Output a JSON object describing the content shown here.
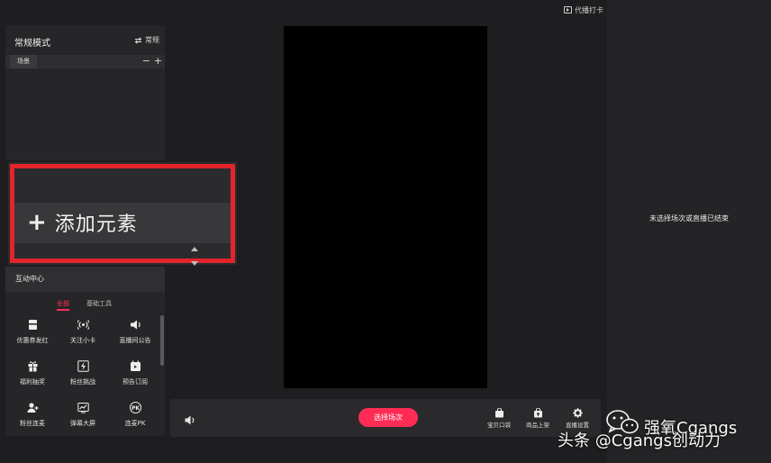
{
  "top_bar": {
    "assist_label": "代播打卡"
  },
  "scene_panel": {
    "title": "常规模式",
    "switch_label": "常规",
    "switch_icon": "swap-icon",
    "scene_tab": "场景",
    "minus": "−",
    "plus": "+"
  },
  "add_element": {
    "plus": "+",
    "label": "添加元素"
  },
  "interaction": {
    "title": "互动中心",
    "tabs": [
      {
        "label": "全部",
        "active": true
      },
      {
        "label": "基础工具",
        "active": false
      }
    ],
    "tools": [
      {
        "label": "优惠券发红",
        "icon": "coupon-icon",
        "glyph": "▣"
      },
      {
        "label": "关注小卡",
        "icon": "signal-icon",
        "glyph": "((•))"
      },
      {
        "label": "直播间公告",
        "icon": "speaker-icon",
        "glyph": "◀)"
      },
      {
        "label": "福利抽奖",
        "icon": "gift-icon",
        "glyph": "▦"
      },
      {
        "label": "粉丝挑战",
        "icon": "flash-icon",
        "glyph": "⚡"
      },
      {
        "label": "预告订阅",
        "icon": "calendar-icon",
        "glyph": "▤"
      },
      {
        "label": "粉丝连麦",
        "icon": "user-add-icon",
        "glyph": "☻"
      },
      {
        "label": "弹幕大屏",
        "icon": "trend-icon",
        "glyph": "▨"
      },
      {
        "label": "连麦PK",
        "icon": "pk-icon",
        "glyph": "PK"
      }
    ]
  },
  "control_bar": {
    "choose_button": "选择场次",
    "buttons": [
      {
        "label": "宝贝口袋",
        "icon": "bag-icon",
        "glyph": "▪"
      },
      {
        "label": "商品上架",
        "icon": "upload-bag-icon",
        "glyph": "⇧"
      },
      {
        "label": "直播设置",
        "icon": "gear-icon",
        "glyph": "⚙"
      }
    ]
  },
  "right_panel": {
    "message": "未选择场次或直播已结束"
  },
  "watermark": {
    "name": "强氧Cgangs",
    "source": "头条 @Cgangs创动力"
  },
  "colors": {
    "accent": "#fe2c55",
    "highlight": "#e3242b",
    "background": "#1e1e20"
  }
}
